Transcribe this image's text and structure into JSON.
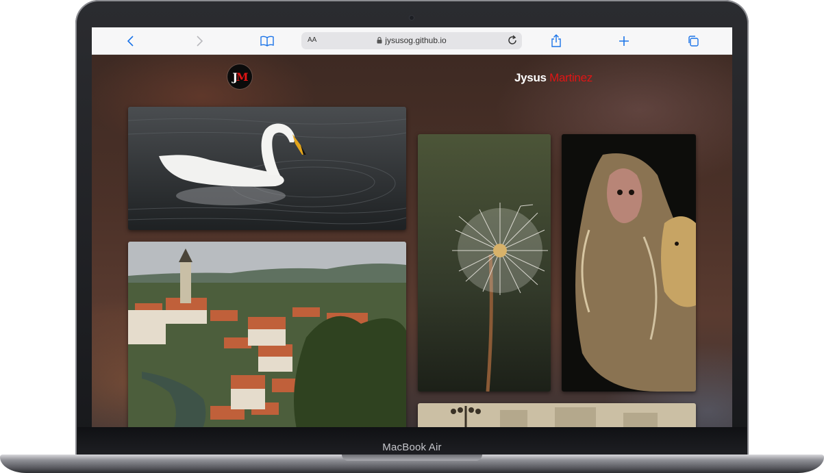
{
  "device": {
    "model_label": "MacBook Air"
  },
  "browser": {
    "reader_label": "AA",
    "url": "jysusog.github.io",
    "icons": {
      "back": "chevron-left-icon",
      "forward": "chevron-right-icon",
      "bookmarks": "book-icon",
      "lock": "lock-icon",
      "reload": "reload-icon",
      "share": "share-icon",
      "new_tab": "plus-icon",
      "tabs": "tabs-icon"
    }
  },
  "site": {
    "logo": {
      "left": "J",
      "right": "M"
    },
    "name_first": "Jysus",
    "name_last": "Martinez",
    "accent_color": "#e01515"
  },
  "gallery": [
    {
      "subject": "swan-on-water"
    },
    {
      "subject": "dandelion"
    },
    {
      "subject": "monkeys"
    },
    {
      "subject": "old-town-rooftops"
    },
    {
      "subject": "street-lamp-square"
    }
  ]
}
